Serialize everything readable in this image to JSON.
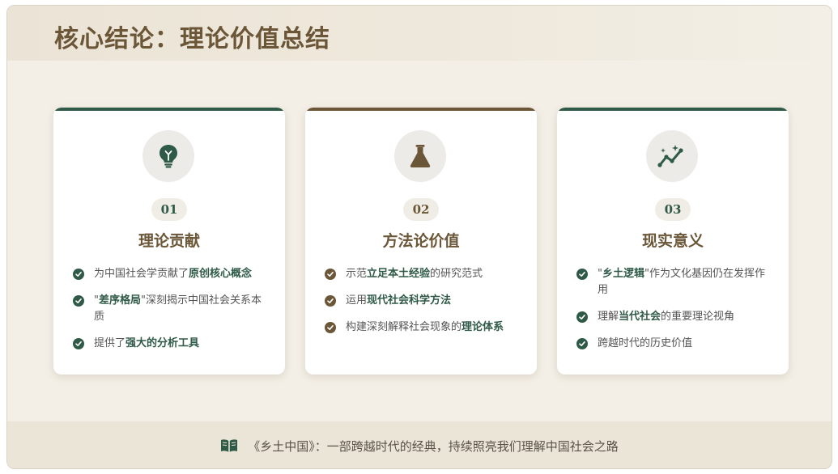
{
  "title": "核心结论：理论价值总结",
  "colors": {
    "green": "#2f5a48",
    "brown": "#6b5638",
    "background": "#f3efe6"
  },
  "cards": [
    {
      "icon": "lightbulb-icon",
      "number": "01",
      "title": "理论贡献",
      "bullets": [
        {
          "pre": "为中国社会学贡献了",
          "bold": "原创核心概念",
          "post": ""
        },
        {
          "pre": "\"",
          "bold": "差序格局",
          "post": "\"深刻揭示中国社会关系本质"
        },
        {
          "pre": "提供了",
          "bold": "强大的分析工具",
          "post": ""
        }
      ]
    },
    {
      "icon": "flask-icon",
      "number": "02",
      "title": "方法论价值",
      "bullets": [
        {
          "pre": "示范",
          "bold": "立足本土经验",
          "post": "的研究范式"
        },
        {
          "pre": "运用",
          "bold": "现代社会科学方法",
          "post": ""
        },
        {
          "pre": "构建深刻解释社会现象的",
          "bold": "理论体系",
          "post": ""
        }
      ]
    },
    {
      "icon": "chart-sparkle-icon",
      "number": "03",
      "title": "现实意义",
      "bullets": [
        {
          "pre": "\"",
          "bold": "乡土逻辑",
          "post": "\"作为文化基因仍在发挥作用"
        },
        {
          "pre": "理解",
          "bold": "当代社会",
          "post": "的重要理论视角"
        },
        {
          "pre": "跨越时代的历史价值",
          "bold": "",
          "post": ""
        }
      ]
    }
  ],
  "footer": {
    "icon": "open-book-icon",
    "text": "《乡土中国》：一部跨越时代的经典，持续照亮我们理解中国社会之路"
  }
}
